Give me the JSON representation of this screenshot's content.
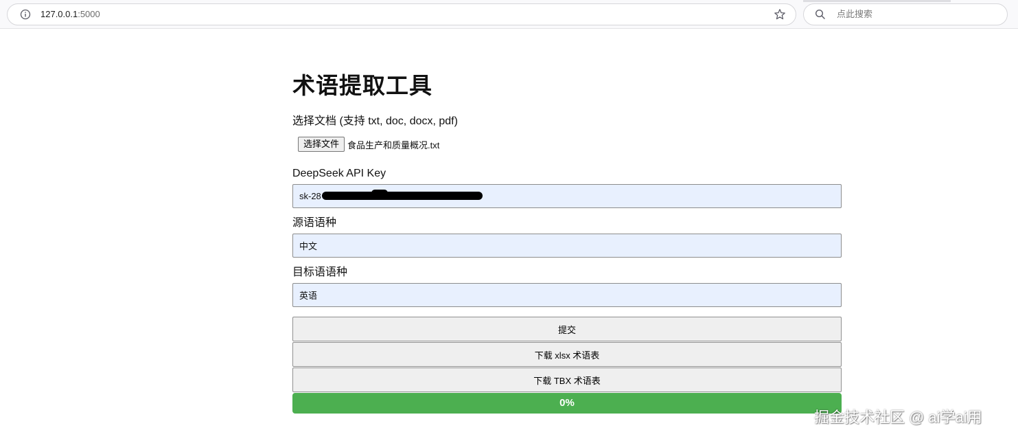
{
  "browser": {
    "url_host": "127.0.0.1",
    "url_port": ":5000",
    "search_placeholder": "点此搜索"
  },
  "page": {
    "title": "术语提取工具",
    "file_label": "选择文档 (支持 txt, doc, docx, pdf)",
    "file_button": "选择文件",
    "file_name": "食品生产和质量概况.txt",
    "api_key_label": "DeepSeek API Key",
    "api_key_value": "sk-28                                        02",
    "source_lang_label": "源语语种",
    "source_lang_value": "中文",
    "target_lang_label": "目标语语种",
    "target_lang_value": "英语",
    "submit_button": "提交",
    "download_xlsx_button": "下载 xlsx 术语表",
    "download_tbx_button": "下载 TBX 术语表",
    "progress_text": "0%"
  },
  "colors": {
    "progress_fill": "#4caf50",
    "input_background": "#e8f0fe"
  },
  "watermark": "掘金技术社区 @ ai学ai用"
}
